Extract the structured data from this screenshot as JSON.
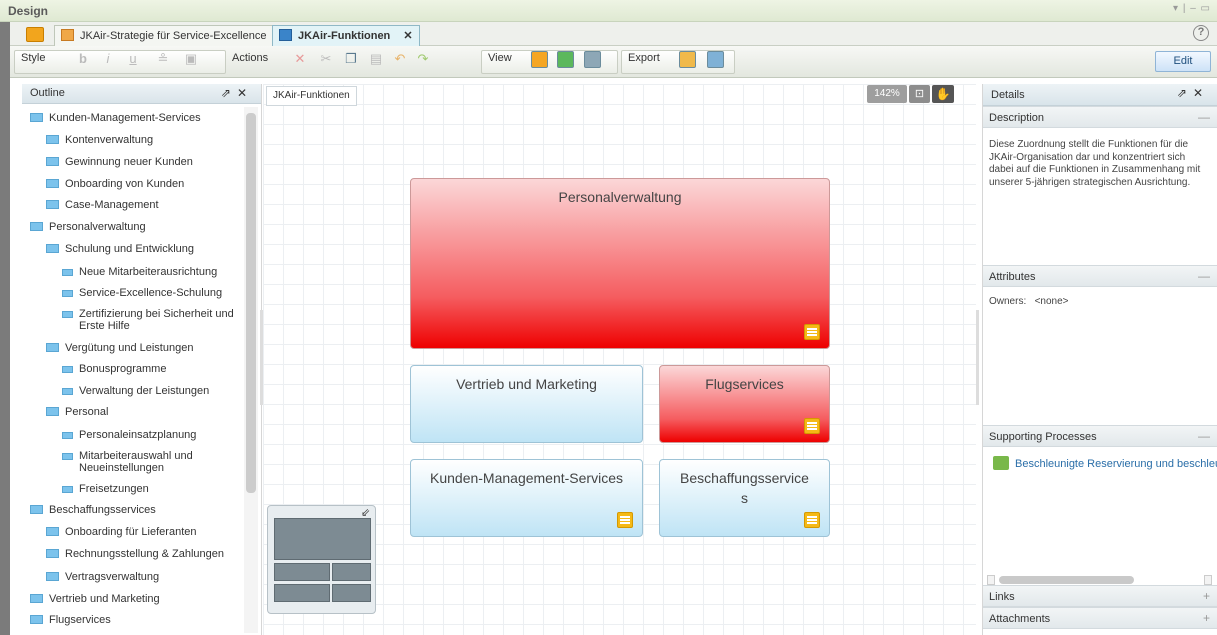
{
  "window": {
    "title": "Design",
    "controls": "▾ | – ▭"
  },
  "tabs": [
    {
      "label": "JKAir-Strategie für Service-Excellence",
      "icon": "strategy-icon"
    },
    {
      "label": "JKAir-Funktionen",
      "icon": "function-map-icon",
      "close": "✕"
    }
  ],
  "help": "?",
  "toolbar": {
    "style_label": "Style",
    "actions_label": "Actions",
    "view_label": "View",
    "export_label": "Export",
    "edit_label": "Edit"
  },
  "outline": {
    "title": "Outline",
    "items": [
      {
        "label": "Kunden-Management-Services"
      },
      {
        "label": "Kontenverwaltung"
      },
      {
        "label": "Gewinnung neuer Kunden"
      },
      {
        "label": "Onboarding von Kunden"
      },
      {
        "label": "Case-Management"
      },
      {
        "label": "Personalverwaltung"
      },
      {
        "label": "Schulung und Entwicklung"
      },
      {
        "label": "Neue Mitarbeiterausrichtung"
      },
      {
        "label": "Service-Excellence-Schulung"
      },
      {
        "label": "Zertifizierung bei Sicherheit und",
        "label2": "Erste Hilfe"
      },
      {
        "label": "Vergütung und Leistungen"
      },
      {
        "label": "Bonusprogramme"
      },
      {
        "label": "Verwaltung der Leistungen"
      },
      {
        "label": "Personal"
      },
      {
        "label": "Personaleinsatzplanung"
      },
      {
        "label": "Mitarbeiterauswahl und",
        "label2": "Neueinstellungen"
      },
      {
        "label": "Freisetzungen"
      },
      {
        "label": "Beschaffungsservices"
      },
      {
        "label": "Onboarding für Lieferanten"
      },
      {
        "label": "Rechnungsstellung & Zahlungen"
      },
      {
        "label": "Vertragsverwaltung"
      },
      {
        "label": "Vertrieb und Marketing"
      },
      {
        "label": "Flugservices"
      }
    ]
  },
  "canvas": {
    "breadcrumb": "JKAir-Funktionen",
    "zoom": "142%",
    "boxes": [
      {
        "label": "Personalverwaltung",
        "color": "#ee0000"
      },
      {
        "label": "Vertrieb und Marketing",
        "color": "#bfe4f5"
      },
      {
        "label": "Flugservices",
        "color": "#ee0000"
      },
      {
        "label": "Kunden-Management-Services",
        "color": "#bfe4f5"
      },
      {
        "label": "Beschaffungsservice",
        "label2": "s",
        "color": "#bfe4f5"
      }
    ]
  },
  "details": {
    "title": "Details",
    "description_label": "Description",
    "description_text": "Diese Zuordnung stellt die Funktionen für die JKAir-Organisation dar und konzentriert sich dabei auf die Funktionen in Zusammenhang mit unserer 5-jährigen strategischen Ausrichtung.",
    "attributes_label": "Attributes",
    "owners_label": "Owners:",
    "owners_value": "<none>",
    "supporting_label": "Supporting Processes",
    "supporting_item": "Beschleunigte Reservierung und beschleu",
    "links_label": "Links",
    "attachments_label": "Attachments"
  }
}
